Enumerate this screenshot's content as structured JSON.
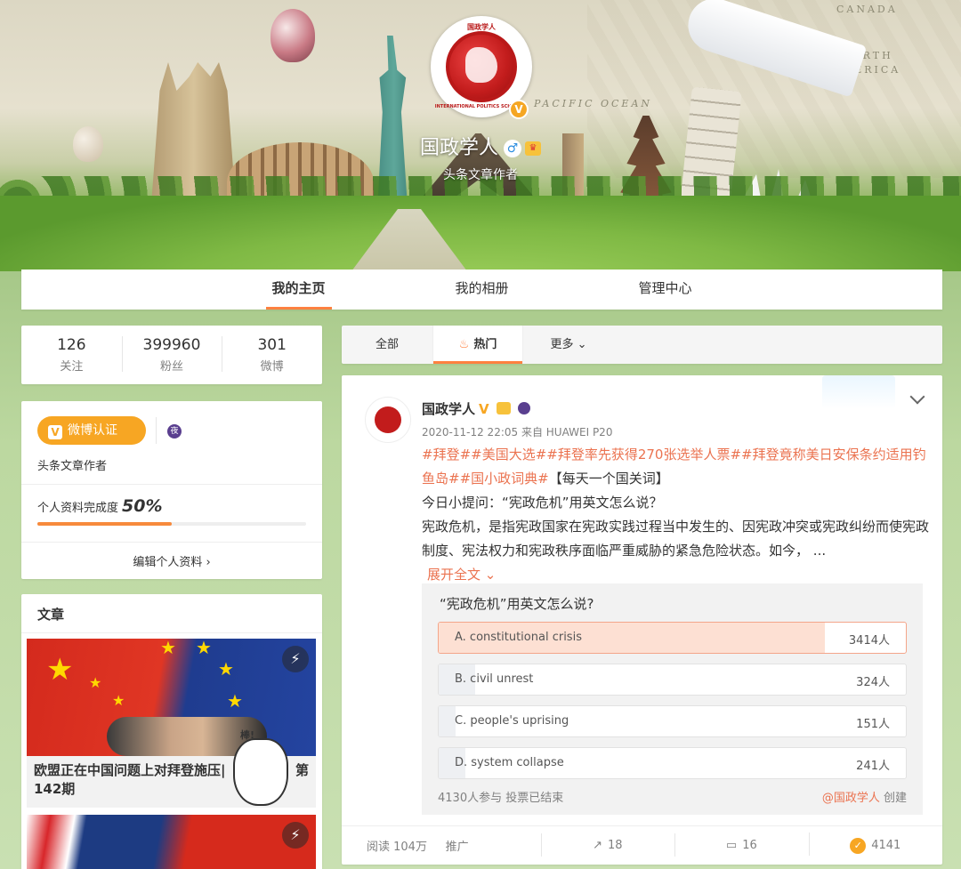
{
  "banner": {
    "map_labels": [
      "CANADA",
      "NORTH",
      "AMERICA",
      "PACIFIC OCEAN"
    ],
    "logo_text_top": "国政学人",
    "logo_text_ring": "INTERNATIONAL POLITICS SCHOLARS",
    "name": "国政学人",
    "gender_icon": "♂",
    "subtitle": "头条文章作者"
  },
  "nav": {
    "tabs": [
      "我的主页",
      "我的相册",
      "管理中心"
    ],
    "active_index": 0,
    "accent": "#ff8140"
  },
  "stats": [
    {
      "value": "126",
      "label": "关注"
    },
    {
      "value": "399960",
      "label": "粉丝"
    },
    {
      "value": "301",
      "label": "微博"
    }
  ],
  "verify": {
    "badge_label": "微博认证",
    "night_icon": "夜",
    "description": "头条文章作者",
    "completion_label": "个人资料完成度",
    "completion_value": "50%",
    "completion_fraction": 0.5,
    "edit_label": "编辑个人资料",
    "edit_chevron": "›"
  },
  "articles": {
    "header": "文章",
    "items": [
      {
        "title": "欧盟正在中国问题上对拜登施压| 第142期",
        "title_left": "欧盟正在中国问题上对拜登施压|",
        "title_right": "第",
        "title_line2": "142期",
        "badge_icon": "bolt-icon",
        "cartoon_text": "棒!"
      },
      {
        "title": "",
        "badge_icon": "bolt-icon"
      }
    ]
  },
  "feed_tabs": {
    "tabs": [
      "全部",
      "热门",
      "更多"
    ],
    "active_index": 1,
    "hot_icon": "flame-icon",
    "more_chevron": "⌄"
  },
  "post": {
    "author": "国政学人",
    "verified_mark": "V",
    "time": "2020-11-12 22:05",
    "source": "来自 HUAWEI P20",
    "tags": "#拜登##美国大选##拜登率先获得270张选举人票##拜登竟称美日安保条约适用钓鱼岛##国小政词典#",
    "bracket": "【每天一个国关词】",
    "line_question": "今日小提问：“宪政危机”用英文怎么说？",
    "line_body": "宪政危机，是指宪政国家在宪政实践过程当中发生的、因宪政冲突或宪政纠纷而使宪政制度、宪法权力和宪政秩序面临严重威胁的紧急危险状态。如今，",
    "ellipsis": "...",
    "expand_label": "展开全文",
    "expand_chevron": "⌄"
  },
  "poll": {
    "question": "“宪政危机”用英文怎么说?",
    "options": [
      {
        "label": "A. constitutional crisis",
        "count": "3414人",
        "votes": 3414,
        "share": 0.8266
      },
      {
        "label": "B. civil unrest",
        "count": "324人",
        "votes": 324,
        "share": 0.0785
      },
      {
        "label": "C. people's uprising",
        "count": "151人",
        "votes": 151,
        "share": 0.0366
      },
      {
        "label": "D. system collapse",
        "count": "241人",
        "votes": 241,
        "share": 0.0584
      }
    ],
    "footer": "4130人参与 投票已结束",
    "creator_name": "@国政学人",
    "creator_suffix": "创建"
  },
  "actions": {
    "reads": "阅读 104万",
    "promote": "推广",
    "forward_icon": "↗",
    "forward": "18",
    "comment_icon": "▭",
    "comment": "16",
    "like_icon": "👍",
    "like": "4141"
  },
  "colors": {
    "accent": "#ff8140",
    "link": "#eb7350",
    "verified": "#f7a623"
  }
}
